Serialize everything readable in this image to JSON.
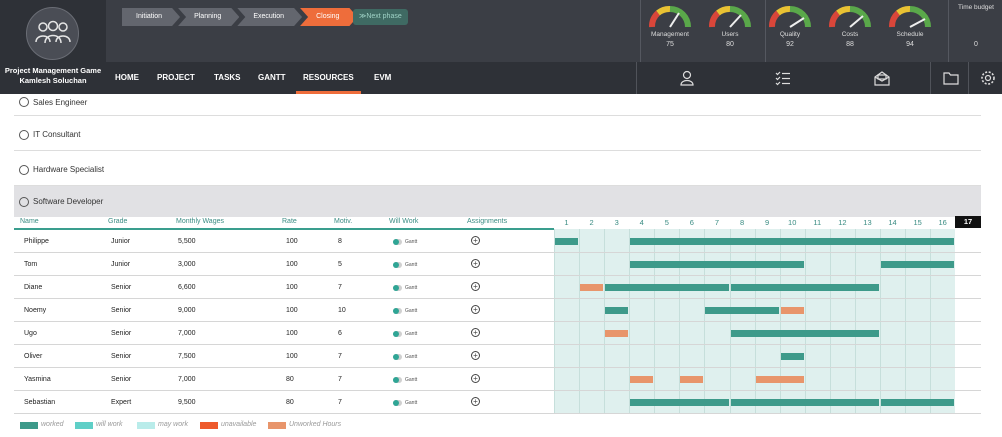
{
  "app": {
    "title_line1": "Project Management Game",
    "title_line2": "Kamlesh Soluchan"
  },
  "phases": [
    "Initiation",
    "Planning",
    "Execution",
    "Closing"
  ],
  "active_phase": "Closing",
  "next_phase_label": "≫Next phase",
  "gauges": [
    {
      "label": "Management",
      "value": "75"
    },
    {
      "label": "Users",
      "value": "80"
    },
    {
      "label": "Quality",
      "value": "92"
    },
    {
      "label": "Costs",
      "value": "88"
    },
    {
      "label": "Schedule",
      "value": "94"
    }
  ],
  "time_budget": {
    "label": "Time budget",
    "value": "0"
  },
  "nav": [
    "HOME",
    "PROJECT",
    "TASKS",
    "GANTT",
    "RESOURCES",
    "EVM"
  ],
  "nav_active": "RESOURCES",
  "nav_icons": [
    "user-icon",
    "checklist-icon",
    "inbox-icon",
    "folder-icon",
    "settings-icon"
  ],
  "roles_collapsed": [
    "Sales Engineer",
    "IT Consultant",
    "Hardware Specialist"
  ],
  "role_expanded": "Software Developer",
  "columns": {
    "name": "Name",
    "grade": "Grade",
    "wages": "Monthly Wages",
    "rate": "Rate",
    "motiv": "Motiv.",
    "will_work": "Will Work",
    "assignments": "Assignments"
  },
  "weeks": [
    "1",
    "2",
    "3",
    "4",
    "5",
    "6",
    "7",
    "8",
    "9",
    "10",
    "11",
    "12",
    "13",
    "14",
    "15",
    "16"
  ],
  "current_week": "17",
  "toggle_label": "Gantt",
  "people": [
    {
      "name": "Philippe",
      "grade": "Junior",
      "wages": "5,500",
      "rate": "100",
      "motiv": "8",
      "bars": [
        {
          "type": "worked",
          "start": 1,
          "end": 1
        },
        {
          "type": "worked",
          "start": 4,
          "end": 16
        }
      ]
    },
    {
      "name": "Tom",
      "grade": "Junior",
      "wages": "3,000",
      "rate": "100",
      "motiv": "5",
      "bars": [
        {
          "type": "worked",
          "start": 4,
          "end": 10
        },
        {
          "type": "worked",
          "start": 14,
          "end": 16
        }
      ]
    },
    {
      "name": "Diane",
      "grade": "Senior",
      "wages": "6,600",
      "rate": "100",
      "motiv": "7",
      "bars": [
        {
          "type": "unworked",
          "start": 2,
          "end": 2
        },
        {
          "type": "worked",
          "start": 3,
          "end": 7
        },
        {
          "type": "worked",
          "start": 8,
          "end": 13
        }
      ]
    },
    {
      "name": "Noemy",
      "grade": "Senior",
      "wages": "9,000",
      "rate": "100",
      "motiv": "10",
      "bars": [
        {
          "type": "worked",
          "start": 3,
          "end": 3
        },
        {
          "type": "worked",
          "start": 7,
          "end": 9
        },
        {
          "type": "unworked",
          "start": 10,
          "end": 10
        }
      ]
    },
    {
      "name": "Ugo",
      "grade": "Senior",
      "wages": "7,000",
      "rate": "100",
      "motiv": "6",
      "bars": [
        {
          "type": "unworked",
          "start": 3,
          "end": 3
        },
        {
          "type": "worked",
          "start": 8,
          "end": 13
        }
      ]
    },
    {
      "name": "Oliver",
      "grade": "Senior",
      "wages": "7,500",
      "rate": "100",
      "motiv": "7",
      "bars": [
        {
          "type": "worked",
          "start": 10,
          "end": 10
        }
      ]
    },
    {
      "name": "Yasmina",
      "grade": "Senior",
      "wages": "7,000",
      "rate": "80",
      "motiv": "7",
      "bars": [
        {
          "type": "unworked",
          "start": 4,
          "end": 4
        },
        {
          "type": "unworked",
          "start": 6,
          "end": 6
        },
        {
          "type": "unworked",
          "start": 9,
          "end": 10
        }
      ]
    },
    {
      "name": "Sebastian",
      "grade": "Expert",
      "wages": "9,500",
      "rate": "80",
      "motiv": "7",
      "bars": [
        {
          "type": "worked",
          "start": 4,
          "end": 7
        },
        {
          "type": "worked",
          "start": 8,
          "end": 13
        },
        {
          "type": "worked",
          "start": 14,
          "end": 16
        }
      ]
    }
  ],
  "legend": [
    {
      "label": "worked",
      "color": "#3d9a8a"
    },
    {
      "label": "will work",
      "color": "#5fcfc7"
    },
    {
      "label": "may work",
      "color": "#b9ecea"
    },
    {
      "label": "unavailable",
      "color": "#ee5a2c"
    },
    {
      "label": "Unworked Hours",
      "color": "#e8956b"
    }
  ],
  "colors": {
    "accent": "#ee6d3b",
    "worked": "#3d9a8a",
    "unworked": "#e8956b",
    "grid": "#dff0ee"
  }
}
